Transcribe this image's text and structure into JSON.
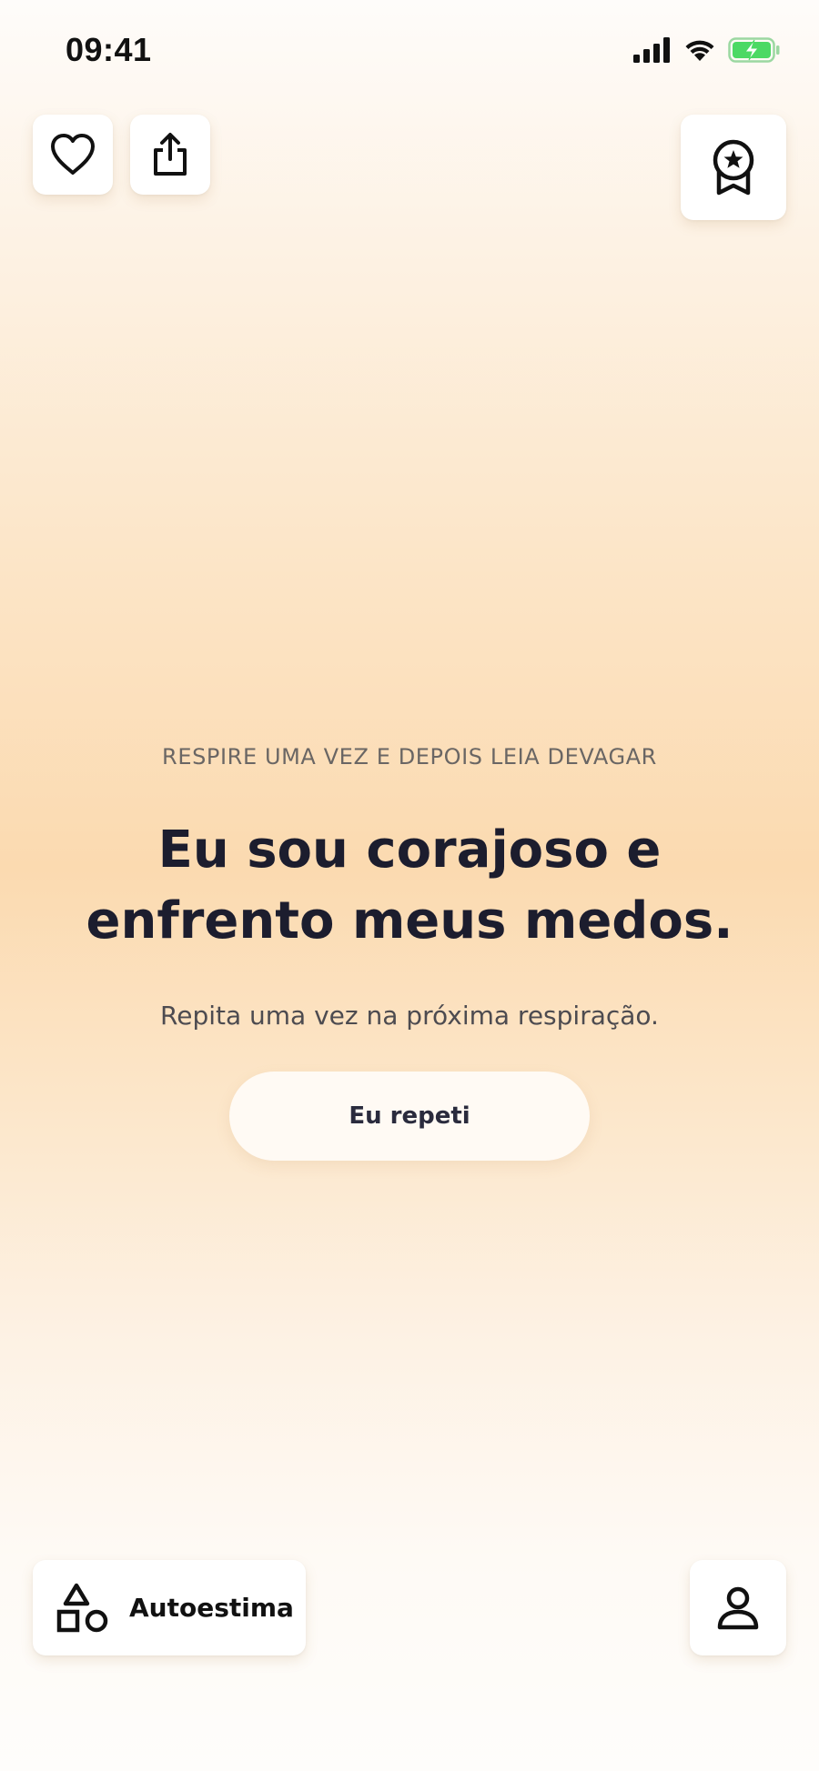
{
  "status_bar": {
    "time": "09:41",
    "icons": [
      "cellular-signal-icon",
      "wifi-icon",
      "battery-charging-icon"
    ]
  },
  "top_actions": {
    "favorite_icon": "heart-icon",
    "share_icon": "share-icon",
    "achievements_icon": "award-ribbon-icon"
  },
  "content": {
    "instruction": "RESPIRE UMA VEZ E DEPOIS LEIA DEVAGAR",
    "affirmation": "Eu sou corajoso e enfrento meus medos.",
    "repeat_hint": "Repita uma vez na próxima respiração.",
    "repeat_button_label": "Eu repeti"
  },
  "bottom_bar": {
    "category_icon": "shapes-icon",
    "category_label": "Autoestima",
    "profile_icon": "user-icon"
  },
  "colors": {
    "text_primary": "#1c1d2e",
    "gradient_peak": "#fbdab0",
    "battery_green": "#4cd964"
  }
}
